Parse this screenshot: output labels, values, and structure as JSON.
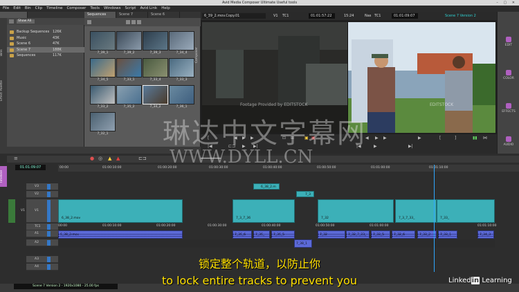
{
  "window": {
    "title": "Avid Media Composer Ultimate Useful tools"
  },
  "menu": [
    "File",
    "Edit",
    "Bin",
    "Clip",
    "Timeline",
    "Composer",
    "Tools",
    "Windows",
    "Script",
    "Avid Link",
    "Help"
  ],
  "bin_panel": {
    "tabs": [
      "Bins",
      "Effect Palette"
    ],
    "show_all": "Show All",
    "items": [
      {
        "name": "Backup Sequences",
        "size": "126K"
      },
      {
        "name": "Music",
        "size": "43K"
      },
      {
        "name": "Scene 6",
        "size": "47K"
      },
      {
        "name": "Scene 7",
        "size": "188K"
      },
      {
        "name": "Sequences",
        "size": "117K"
      }
    ]
  },
  "thumb_bin": {
    "tabs": [
      "Sequences",
      "Scene 7",
      "Scene 6"
    ],
    "thumbs": [
      "7_39_1",
      "7_39_2",
      "7_39_3",
      "7_34_4",
      "7_34_5",
      "7_33_1",
      "7_33_4",
      "7_33_3",
      "7_33_2",
      "7_35_2",
      "7_34_2",
      "7_36_1",
      "7_32_1"
    ]
  },
  "composer": {
    "panel_label": "Composer",
    "source_clip": "6_39_2.mov.Copy.01",
    "source_track": "V1",
    "source_tc_label": "TC1",
    "source_tc": "01:01:57:22",
    "duration": "15:24",
    "record_label": "Nas",
    "record_tc_label": "TC1",
    "record_tc": "01:01:09:07",
    "sequence_name": "Scene 7 Version 2",
    "source_watermark": "Footage Provided by EDITSTOCK",
    "record_watermark": "EDITSTOCK"
  },
  "right_palette": [
    "EDIT",
    "COLOR",
    "EFFECTS",
    "AUDIO"
  ],
  "timeline": {
    "current_tc": "01:01:09:07",
    "ruler": [
      "00:00",
      "01:00:10:00",
      "01:00:20:00",
      "01:00:30:00",
      "01:00:40:00",
      "01:00:50:00",
      "01:01:00:00",
      "01:01:10:00"
    ],
    "tc_track_ruler": [
      "00:00",
      "01:00:10:00",
      "01:00:20:00",
      "01:00:30:00",
      "01:00:40:00",
      "01:00:50:00",
      "01:01:00:00",
      "01:01:10:00"
    ],
    "tracks": [
      "V3",
      "V2",
      "V1",
      "TC1",
      "A1",
      "A2",
      "A3",
      "A4"
    ],
    "v3_clip": "6_38_2.m",
    "v2_clip": "7_3",
    "v1_clips": [
      "6_38_2.mov",
      "7_3_7_36",
      "7_32",
      "7_3_7_33_",
      "7_33_"
    ],
    "a1_clips": [
      "6_38_2.mov",
      "7_36_6",
      "7_36_",
      "7_36_5",
      "7_32",
      "7_32_7_33_",
      "7_33_5",
      "7_32_6",
      "7_33_2",
      "7_33_1",
      "7_34_3"
    ],
    "a3_clip": "7_38_1",
    "sequence_label": "Timeline"
  },
  "status_bar": "Scene 7 Version 2 - 1920x1080 - 25.00 fps",
  "subtitles": {
    "cn": "锁定整个轨道，以防止你",
    "en": "to lock entire tracks to prevent you"
  },
  "overlay": {
    "cn": "琳达中文字幕网",
    "url": "WWW.DYLL.CN",
    "brand": "Linked",
    "brand_in": "in",
    "brand_tail": "Learning"
  }
}
